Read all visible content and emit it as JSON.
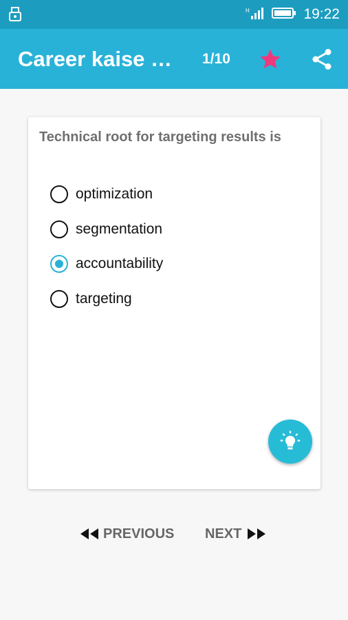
{
  "status_bar": {
    "time": "19:22",
    "left_icon": "usb-icon",
    "signal_icon": "signal-icon",
    "battery_icon": "battery-icon"
  },
  "app_bar": {
    "title": "Career kaise c...",
    "counter": "1/10",
    "star_icon": "star-icon",
    "share_icon": "share-icon",
    "colors": {
      "status": "#1c9dc0",
      "bar": "#29b2d8",
      "star": "#ee3a7d"
    }
  },
  "quiz": {
    "question": "Technical root for targeting results is",
    "options": [
      {
        "label": "optimization",
        "selected": false
      },
      {
        "label": "segmentation",
        "selected": false
      },
      {
        "label": "accountability",
        "selected": true
      },
      {
        "label": "targeting",
        "selected": false
      }
    ],
    "hint_icon": "lightbulb-icon"
  },
  "navigation": {
    "previous": "PREVIOUS",
    "next": "NEXT",
    "previous_icon": "rewind-icon",
    "next_icon": "fast-forward-icon"
  }
}
